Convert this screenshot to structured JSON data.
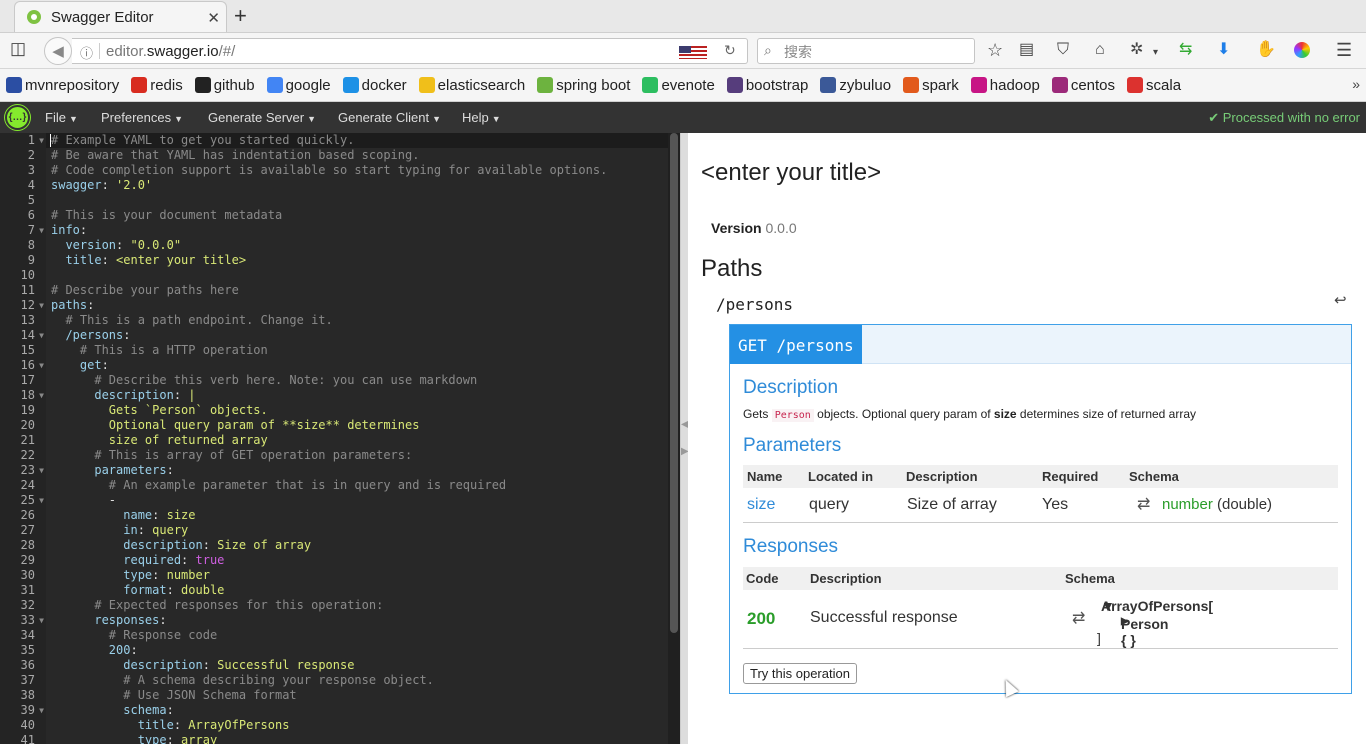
{
  "browser": {
    "tab_title": "Swagger Editor",
    "new_tab_label": "+",
    "url_domain_prefix": "editor.",
    "url_domain": "swagger.io",
    "url_path": "/#/",
    "search_placeholder": "搜索"
  },
  "bookmarks": [
    {
      "label": "mvnrepository",
      "icon": "mvn-icon",
      "color": "#2b4ea3"
    },
    {
      "label": "redis",
      "icon": "redis-icon",
      "color": "#d82c20"
    },
    {
      "label": "github",
      "icon": "github-icon",
      "color": "#222222"
    },
    {
      "label": "google",
      "icon": "google-icon",
      "color": "#4285f4"
    },
    {
      "label": "docker",
      "icon": "docker-icon",
      "color": "#1d91e6"
    },
    {
      "label": "elasticsearch",
      "icon": "elasticsearch-icon",
      "color": "#f0bf1a"
    },
    {
      "label": "spring boot",
      "icon": "spring-icon",
      "color": "#6db33f"
    },
    {
      "label": "evenote",
      "icon": "evernote-icon",
      "color": "#2dbe60"
    },
    {
      "label": "bootstrap",
      "icon": "bootstrap-icon",
      "color": "#563d7c"
    },
    {
      "label": "zybuluo",
      "icon": "zybuluo-icon",
      "color": "#3b5998"
    },
    {
      "label": "spark",
      "icon": "spark-icon",
      "color": "#e25a1c"
    },
    {
      "label": "hadoop",
      "icon": "hadoop-icon",
      "color": "#c71585"
    },
    {
      "label": "centos",
      "icon": "centos-icon",
      "color": "#9c2a7a"
    },
    {
      "label": "scala",
      "icon": "scala-icon",
      "color": "#dc322f"
    }
  ],
  "app": {
    "menus": [
      "File",
      "Preferences",
      "Generate Server",
      "Generate Client",
      "Help"
    ],
    "status": "Processed with no error"
  },
  "editor": {
    "line_numbers": [
      "1",
      "2",
      "3",
      "4",
      "5",
      "6",
      "7",
      "8",
      "9",
      "10",
      "11",
      "12",
      "13",
      "14",
      "15",
      "16",
      "17",
      "18",
      "19",
      "20",
      "21",
      "22",
      "23",
      "24",
      "25",
      "26",
      "27",
      "28",
      "29",
      "30",
      "31",
      "32",
      "33",
      "34",
      "35",
      "36",
      "37",
      "38",
      "39",
      "40",
      "41"
    ],
    "lines": [
      [
        {
          "t": "# Example YAML to get you started quickly.",
          "c": "com"
        }
      ],
      [
        {
          "t": "# Be aware that YAML has indentation based scoping.",
          "c": "com"
        }
      ],
      [
        {
          "t": "# Code completion support is available so start typing for available options.",
          "c": "com"
        }
      ],
      [
        {
          "t": "swagger",
          "c": "key"
        },
        {
          "t": ": ",
          "c": ""
        },
        {
          "t": "'2.0'",
          "c": "str"
        }
      ],
      [],
      [
        {
          "t": "# This is your document metadata",
          "c": "com"
        }
      ],
      [
        {
          "t": "info",
          "c": "key"
        },
        {
          "t": ":",
          "c": ""
        }
      ],
      [
        {
          "t": "  version",
          "c": "key"
        },
        {
          "t": ": ",
          "c": ""
        },
        {
          "t": "\"0.0.0\"",
          "c": "str"
        }
      ],
      [
        {
          "t": "  title",
          "c": "key"
        },
        {
          "t": ": ",
          "c": ""
        },
        {
          "t": "<enter your title>",
          "c": "str"
        }
      ],
      [],
      [
        {
          "t": "# Describe your paths here",
          "c": "com"
        }
      ],
      [
        {
          "t": "paths",
          "c": "key"
        },
        {
          "t": ":",
          "c": ""
        }
      ],
      [
        {
          "t": "  # This is a path endpoint. Change it.",
          "c": "com"
        }
      ],
      [
        {
          "t": "  /persons",
          "c": "key"
        },
        {
          "t": ":",
          "c": ""
        }
      ],
      [
        {
          "t": "    # This is a HTTP operation",
          "c": "com"
        }
      ],
      [
        {
          "t": "    get",
          "c": "key"
        },
        {
          "t": ":",
          "c": ""
        }
      ],
      [
        {
          "t": "      # Describe this verb here. Note: you can use markdown",
          "c": "com"
        }
      ],
      [
        {
          "t": "      description",
          "c": "key"
        },
        {
          "t": ": ",
          "c": ""
        },
        {
          "t": "|",
          "c": "str"
        }
      ],
      [
        {
          "t": "        Gets `Person` objects.",
          "c": "str"
        }
      ],
      [
        {
          "t": "        Optional query param of **size** determines",
          "c": "str"
        }
      ],
      [
        {
          "t": "        size of returned array",
          "c": "str"
        }
      ],
      [
        {
          "t": "      # This is array of GET operation parameters:",
          "c": "com"
        }
      ],
      [
        {
          "t": "      parameters",
          "c": "key"
        },
        {
          "t": ":",
          "c": ""
        }
      ],
      [
        {
          "t": "        # An example parameter that is in query and is required",
          "c": "com"
        }
      ],
      [
        {
          "t": "        -",
          "c": ""
        }
      ],
      [
        {
          "t": "          name",
          "c": "key"
        },
        {
          "t": ": ",
          "c": ""
        },
        {
          "t": "size",
          "c": "str"
        }
      ],
      [
        {
          "t": "          in",
          "c": "key"
        },
        {
          "t": ": ",
          "c": ""
        },
        {
          "t": "query",
          "c": "str"
        }
      ],
      [
        {
          "t": "          description",
          "c": "key"
        },
        {
          "t": ": ",
          "c": ""
        },
        {
          "t": "Size of array",
          "c": "str"
        }
      ],
      [
        {
          "t": "          required",
          "c": "key"
        },
        {
          "t": ": ",
          "c": ""
        },
        {
          "t": "true",
          "c": "bool"
        }
      ],
      [
        {
          "t": "          type",
          "c": "key"
        },
        {
          "t": ": ",
          "c": ""
        },
        {
          "t": "number",
          "c": "str"
        }
      ],
      [
        {
          "t": "          format",
          "c": "key"
        },
        {
          "t": ": ",
          "c": ""
        },
        {
          "t": "double",
          "c": "str"
        }
      ],
      [
        {
          "t": "      # Expected responses for this operation:",
          "c": "com"
        }
      ],
      [
        {
          "t": "      responses",
          "c": "key"
        },
        {
          "t": ":",
          "c": ""
        }
      ],
      [
        {
          "t": "        # Response code",
          "c": "com"
        }
      ],
      [
        {
          "t": "        200",
          "c": "key"
        },
        {
          "t": ":",
          "c": ""
        }
      ],
      [
        {
          "t": "          description",
          "c": "key"
        },
        {
          "t": ": ",
          "c": ""
        },
        {
          "t": "Successful response",
          "c": "str"
        }
      ],
      [
        {
          "t": "          # A schema describing your response object.",
          "c": "com"
        }
      ],
      [
        {
          "t": "          # Use JSON Schema format",
          "c": "com"
        }
      ],
      [
        {
          "t": "          schema",
          "c": "key"
        },
        {
          "t": ":",
          "c": ""
        }
      ],
      [
        {
          "t": "            title",
          "c": "key"
        },
        {
          "t": ": ",
          "c": ""
        },
        {
          "t": "ArrayOfPersons",
          "c": "str"
        }
      ],
      [
        {
          "t": "            type",
          "c": "key"
        },
        {
          "t": ": ",
          "c": ""
        },
        {
          "t": "array",
          "c": "str"
        }
      ]
    ],
    "fold_lines": [
      1,
      7,
      12,
      14,
      16,
      18,
      23,
      25,
      33,
      39
    ]
  },
  "preview": {
    "title": "<enter your title>",
    "version_label": "Version",
    "version_value": "0.0.0",
    "paths_heading": "Paths",
    "path": "/persons",
    "op_verb_path": "GET /persons",
    "description_heading": "Description",
    "description_pre": "Gets ",
    "description_code": "Person",
    "description_mid": " objects. Optional query param of ",
    "description_bold": "size",
    "description_post": " determines size of returned array",
    "parameters_heading": "Parameters",
    "param_columns": [
      "Name",
      "Located in",
      "Description",
      "Required",
      "Schema"
    ],
    "param_row": {
      "name": "size",
      "in": "query",
      "description": "Size of array",
      "required": "Yes",
      "type": "number",
      "format": "(double)"
    },
    "responses_heading": "Responses",
    "resp_columns": [
      "Code",
      "Description",
      "Schema"
    ],
    "resp_row": {
      "code": "200",
      "description": "Successful response",
      "schema_array": "ArrayOfPersons[",
      "schema_item": "Person { }",
      "schema_close": "]"
    },
    "try_button": "Try this operation"
  }
}
